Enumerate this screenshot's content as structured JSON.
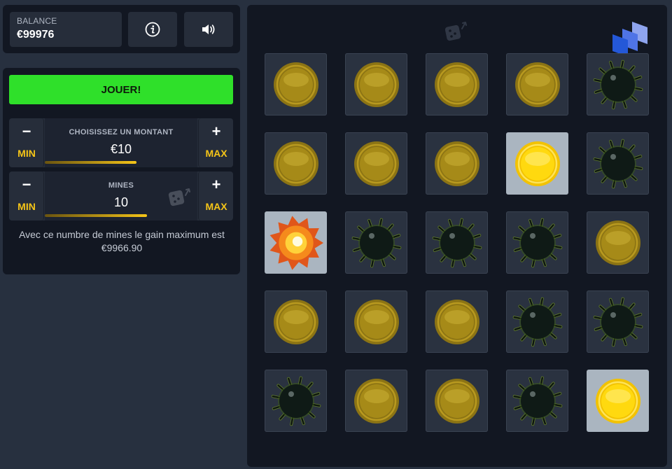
{
  "balance": {
    "label": "BALANCE",
    "value": "€99976"
  },
  "top_buttons": {
    "info_icon": "info-icon",
    "sound_icon": "speaker-icon"
  },
  "play": {
    "label": "JOUER!"
  },
  "amount": {
    "title": "CHOISISSEZ UN MONTANT",
    "value": "€10",
    "minus": "−",
    "plus": "+",
    "min_label": "MIN",
    "max_label": "MAX",
    "slider_fraction": 0.6
  },
  "mines": {
    "title": "MINES",
    "value": "10",
    "minus": "−",
    "plus": "+",
    "min_label": "MIN",
    "max_label": "MAX",
    "slider_fraction": 0.67
  },
  "info": {
    "text": "Avec ce numbre de mines le gain maximum est €9966.90"
  },
  "colors": {
    "play_button": "#2fe02a",
    "accent_gold": "#f5c518",
    "panel": "#121722",
    "background": "#27303f"
  },
  "grid": {
    "rows": 5,
    "cols": 5,
    "tiles": [
      "coin",
      "coin",
      "coin",
      "coin",
      "mine",
      "coin",
      "coin",
      "coin",
      "coin-revealed",
      "mine",
      "explosion",
      "mine",
      "mine",
      "mine",
      "coin",
      "coin",
      "coin",
      "coin",
      "mine",
      "mine",
      "mine",
      "coin",
      "coin",
      "mine",
      "coin-revealed"
    ]
  }
}
